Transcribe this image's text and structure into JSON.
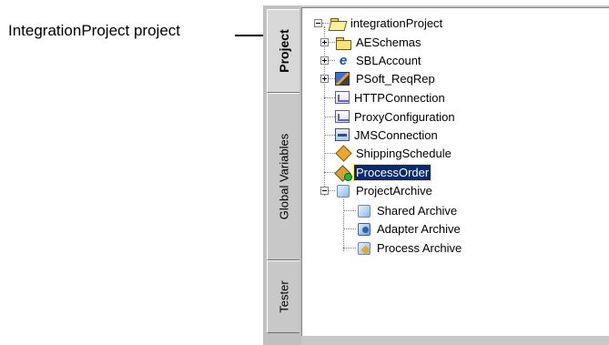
{
  "callout": {
    "label": "IntegrationProject project"
  },
  "tabs": [
    {
      "label": "Project",
      "active": true
    },
    {
      "label": "Global Variables",
      "active": false
    },
    {
      "label": "Tester",
      "active": false
    }
  ],
  "tree": {
    "root": {
      "label": "integrationProject",
      "icon": "folder-open-icon"
    },
    "items": [
      {
        "label": "AESchemas",
        "icon": "folder-icon",
        "expandable": true
      },
      {
        "label": "SBLAccount",
        "icon": "siebel-icon",
        "expandable": true
      },
      {
        "label": "PSoft_ReqRep",
        "icon": "peoplesoft-icon",
        "expandable": true
      },
      {
        "label": "HTTPConnection",
        "icon": "http-connection-icon"
      },
      {
        "label": "ProxyConfiguration",
        "icon": "proxy-config-icon"
      },
      {
        "label": "JMSConnection",
        "icon": "jms-connection-icon"
      },
      {
        "label": "ShippingSchedule",
        "icon": "schedule-icon"
      },
      {
        "label": "ProcessOrder",
        "icon": "process-icon",
        "selected": true
      },
      {
        "label": "ProjectArchive",
        "icon": "archive-icon",
        "expanded": true
      }
    ],
    "archive_children": [
      {
        "label": "Shared Archive",
        "icon": "shared-archive-icon"
      },
      {
        "label": "Adapter Archive",
        "icon": "adapter-archive-icon"
      },
      {
        "label": "Process Archive",
        "icon": "process-archive-icon"
      }
    ]
  }
}
